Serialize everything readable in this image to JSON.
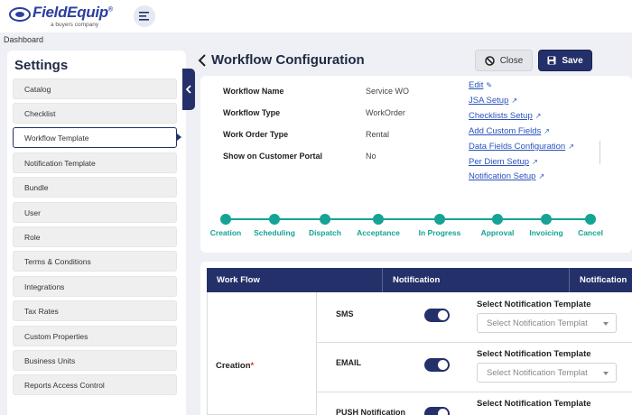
{
  "brand": {
    "name": "FieldEquip",
    "tm": "®",
    "sub": "a buyers company"
  },
  "breadcrumb": "Dashboard",
  "settings": {
    "title": "Settings",
    "items": [
      "Catalog",
      "Checklist",
      "Workflow Template",
      "Notification Template",
      "Bundle",
      "User",
      "Role",
      "Terms & Conditions",
      "Integrations",
      "Tax Rates",
      "Custom Properties",
      "Business Units",
      "Reports Access Control"
    ],
    "active_index": 2
  },
  "page": {
    "title": "Workflow Configuration",
    "close_label": "Close",
    "save_label": "Save"
  },
  "info": {
    "fields": [
      {
        "label": "Workflow Name",
        "value": "Service WO"
      },
      {
        "label": "Workflow Type",
        "value": "WorkOrder"
      },
      {
        "label": "Work Order Type",
        "value": "Rental"
      },
      {
        "label": "Show on Customer Portal",
        "value": "No"
      }
    ],
    "links": [
      "Edit",
      "JSA Setup",
      "Checklists Setup",
      "Add Custom Fields",
      "Data Fields Configuration",
      "Per Diem Setup",
      "Notification Setup"
    ]
  },
  "stages": [
    "Creation",
    "Scheduling",
    "Dispatch",
    "Acceptance",
    "In Progress",
    "Approval",
    "Invoicing",
    "Cancel"
  ],
  "workflow_table": {
    "headers": [
      "Work Flow",
      "Notification",
      "Notification"
    ],
    "stage": "Creation",
    "required_mark": "*",
    "rows": [
      {
        "channel": "SMS",
        "enabled": true,
        "template_label": "Select Notification Template",
        "placeholder": "Select Notification Templat"
      },
      {
        "channel": "EMAIL",
        "enabled": true,
        "template_label": "Select Notification Template",
        "placeholder": "Select Notification Templat"
      },
      {
        "channel": "PUSH Notification",
        "enabled": true,
        "template_label": "Select Notification Template",
        "placeholder": ""
      }
    ]
  },
  "colors": {
    "primary": "#24306a",
    "accent": "#14a394",
    "link": "#2a52be"
  }
}
